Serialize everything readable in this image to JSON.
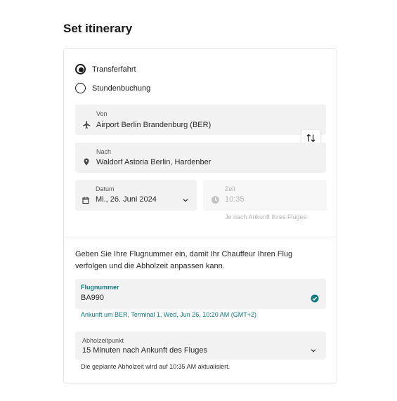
{
  "page": {
    "title": "Set itinerary"
  },
  "trip_type": {
    "options": [
      {
        "label": "Transferfahrt",
        "checked": true
      },
      {
        "label": "Stundenbuchung",
        "checked": false
      }
    ]
  },
  "from": {
    "label": "Von",
    "value": "Airport Berlin Brandenburg (BER)",
    "icon": "airplane-icon"
  },
  "to": {
    "label": "Nach",
    "value": "Waldorf Astoria Berlin, Hardenber",
    "icon": "location-pin-icon"
  },
  "swap": {
    "icon": "swap-arrows-icon"
  },
  "date": {
    "label": "Datum",
    "value": "Mi., 26. Juni 2024",
    "icon": "calendar-icon"
  },
  "time": {
    "label": "Zeit",
    "value": "10:35",
    "hint": "Je nach Ankunft Ihres Fluges",
    "icon": "clock-icon"
  },
  "flight": {
    "info": "Geben Sie Ihre Flugnummer ein, damit Ihr Chauffeur Ihren Flug verfolgen und die Abholzeit anpassen kann.",
    "label": "Flugnummer",
    "value": "BA990",
    "arrival": "Ankunft um BER, Terminal 1, Wed, Jun 26, 10:20 AM (GMT+2)",
    "status_icon": "check-circle-icon"
  },
  "pickup": {
    "label": "Abholzeitpunkt",
    "value": "15 Minuten nach Ankunft des Fluges",
    "note": "Die geplante Abholzeit wird auf 10:35 AM aktualisiert."
  },
  "colors": {
    "accent": "#0f7a80",
    "field_bg": "#f2f2f2"
  }
}
